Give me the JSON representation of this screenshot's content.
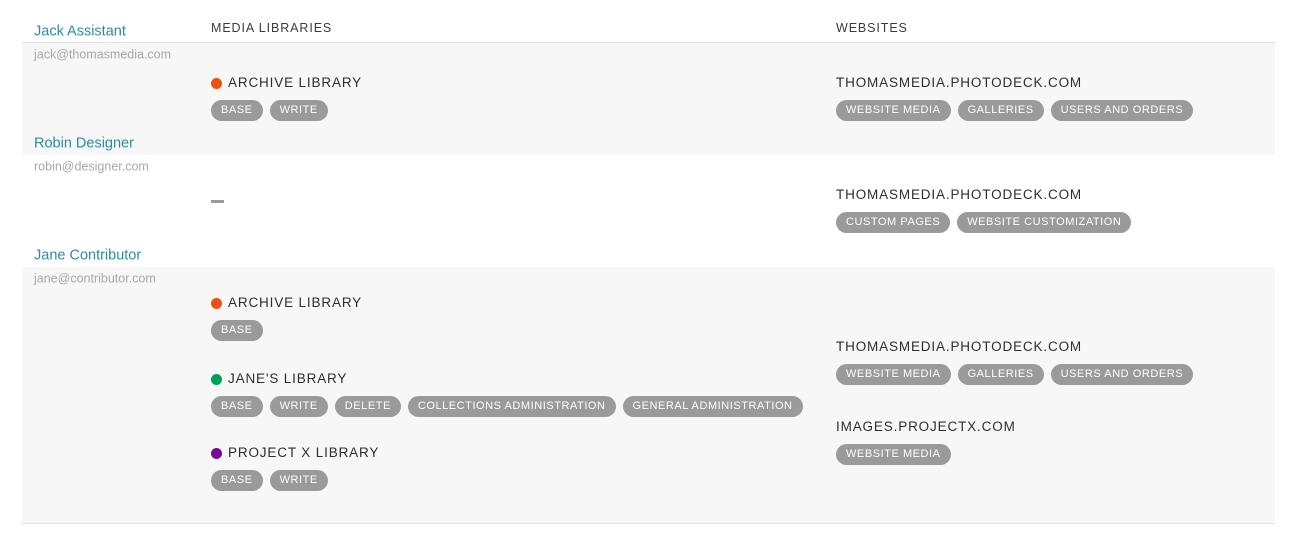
{
  "columns": {
    "user": "",
    "media_libraries": "MEDIA LIBRARIES",
    "websites": "WEBSITES"
  },
  "colors": {
    "link": "#2e8ca0",
    "pill_bg": "#9a9a9a",
    "row_shaded": "#f7f7f7",
    "row_plain": "#ffffff",
    "dot_archive": "#ea5312",
    "dot_janes": "#00a05a",
    "dot_projectx": "#7a0799"
  },
  "empty_marker": "–",
  "rows": [
    {
      "user": {
        "name": "Jack Assistant",
        "email": "jack@thomasmedia.com"
      },
      "media_libraries": [
        {
          "name": "ARCHIVE LIBRARY",
          "dot_color": "#ea5312",
          "permissions": [
            "BASE",
            "WRITE"
          ]
        }
      ],
      "websites": [
        {
          "name": "THOMASMEDIA.PHOTODECK.COM",
          "permissions": [
            "WEBSITE MEDIA",
            "GALLERIES",
            "USERS AND ORDERS"
          ]
        }
      ]
    },
    {
      "user": {
        "name": "Robin Designer",
        "email": "robin@designer.com"
      },
      "media_libraries": [],
      "websites": [
        {
          "name": "THOMASMEDIA.PHOTODECK.COM",
          "permissions": [
            "CUSTOM PAGES",
            "WEBSITE CUSTOMIZATION"
          ]
        }
      ]
    },
    {
      "user": {
        "name": "Jane Contributor",
        "email": "jane@contributor.com"
      },
      "media_libraries": [
        {
          "name": "ARCHIVE LIBRARY",
          "dot_color": "#ea5312",
          "permissions": [
            "BASE"
          ]
        },
        {
          "name": "JANE'S LIBRARY",
          "dot_color": "#00a05a",
          "permissions": [
            "BASE",
            "WRITE",
            "DELETE",
            "COLLECTIONS ADMINISTRATION",
            "GENERAL ADMINISTRATION"
          ]
        },
        {
          "name": "PROJECT X LIBRARY",
          "dot_color": "#7a0799",
          "permissions": [
            "BASE",
            "WRITE"
          ]
        }
      ],
      "websites": [
        {
          "name": "THOMASMEDIA.PHOTODECK.COM",
          "permissions": [
            "WEBSITE MEDIA",
            "GALLERIES",
            "USERS AND ORDERS"
          ]
        },
        {
          "name": "IMAGES.PROJECTX.COM",
          "permissions": [
            "WEBSITE MEDIA"
          ]
        }
      ]
    }
  ]
}
